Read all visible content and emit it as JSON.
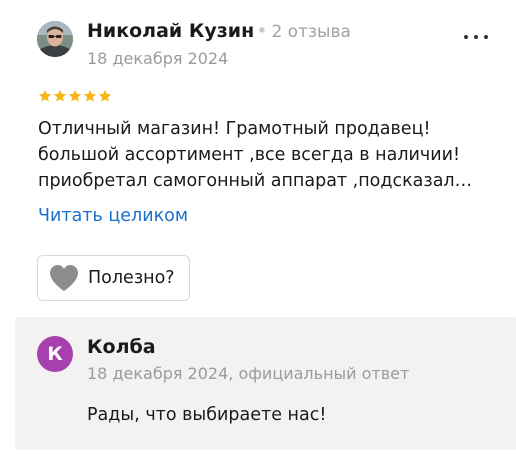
{
  "review": {
    "author_name": "Николай Кузин",
    "separator": "•",
    "author_reviews": "2 отзыва",
    "date": "18 декабря 2024",
    "rating": 5,
    "text_lines": [
      "Отличный магазин! Грамотный продавец!",
      "большой ассортимент ,все всегда в наличии!",
      "приобретал самогонный аппарат ,подсказал…"
    ],
    "read_more_label": "Читать целиком",
    "helpful_label": "Полезно?",
    "star_color": "#f6b619",
    "link_color": "#1a6fcc"
  },
  "reply": {
    "org_initial": "К",
    "org_name": "Колба",
    "meta": "18 декабря 2024, официальный ответ",
    "text": "Рады, что выбираете нас!",
    "avatar_color": "#a83fae",
    "background_color": "#f2f2f2"
  }
}
